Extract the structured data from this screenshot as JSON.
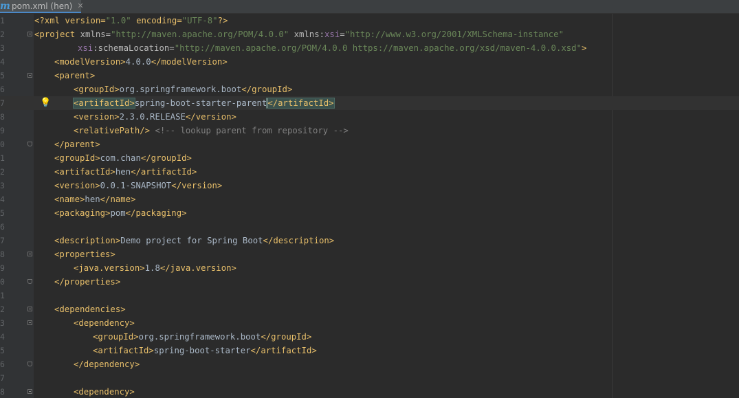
{
  "tab": {
    "icon": "m",
    "icon_name": "maven-icon",
    "label": "pom.xml (hen)",
    "close": "✕"
  },
  "gutter": {
    "line_numbers": [
      "1",
      "2",
      "3",
      "4",
      "5",
      "6",
      "7",
      "8",
      "9",
      "0",
      "1",
      "2",
      "3",
      "4",
      "5",
      "6",
      "7",
      "8",
      "9",
      "0",
      "1",
      "2",
      "3",
      "4",
      "5",
      "6",
      "7",
      "8"
    ]
  },
  "editor": {
    "lines": [
      [
        "<?xml version=",
        "\"1.0\"",
        " encoding=",
        "\"UTF-8\"",
        "?>"
      ],
      [
        "<project",
        " xmlns=",
        "\"http://maven.apache.org/POM/4.0.0\"",
        " xmlns:",
        "xsi",
        "=",
        "\"http://www.w3.org/2001/XMLSchema-instance\""
      ],
      [
        "xsi",
        ":schemaLocation=",
        "\"http://maven.apache.org/POM/4.0.0 https://maven.apache.org/xsd/maven-4.0.0.xsd\"",
        ">"
      ],
      [
        "<modelVersion>",
        "4.0.0",
        "</modelVersion>"
      ],
      [
        "<parent>"
      ],
      [
        "<groupId>",
        "org.springframework.boot",
        "</groupId>"
      ],
      [
        "<artifactId>",
        "spring-boot-starter-parent",
        "</artifactId>"
      ],
      [
        "<version>",
        "2.3.0.RELEASE",
        "</version>"
      ],
      [
        "<relativePath/>",
        " ",
        "<!-- lookup parent from repository -->"
      ],
      [
        "</parent>"
      ],
      [
        "<groupId>",
        "com.chan",
        "</groupId>"
      ],
      [
        "<artifactId>",
        "hen",
        "</artifactId>"
      ],
      [
        "<version>",
        "0.0.1-SNAPSHOT",
        "</version>"
      ],
      [
        "<name>",
        "hen",
        "</name>"
      ],
      [
        "<packaging>",
        "pom",
        "</packaging>"
      ],
      [],
      [
        "<description>",
        "Demo project for Spring Boot",
        "</description>"
      ],
      [
        "<properties>"
      ],
      [
        "<java.version>",
        "1.8",
        "</java.version>"
      ],
      [
        "</properties>"
      ],
      [],
      [
        "<dependencies>"
      ],
      [
        "<dependency>"
      ],
      [
        "<groupId>",
        "org.springframework.boot",
        "</groupId>"
      ],
      [
        "<artifactId>",
        "spring-boot-starter",
        "</artifactId>"
      ],
      [
        "</dependency>"
      ],
      [],
      [
        "<dependency>"
      ]
    ]
  },
  "colors": {
    "tag": "#e8bf6a",
    "string": "#6a8759",
    "namespace": "#9876aa",
    "comment": "#808080",
    "text": "#a9b7c6"
  }
}
